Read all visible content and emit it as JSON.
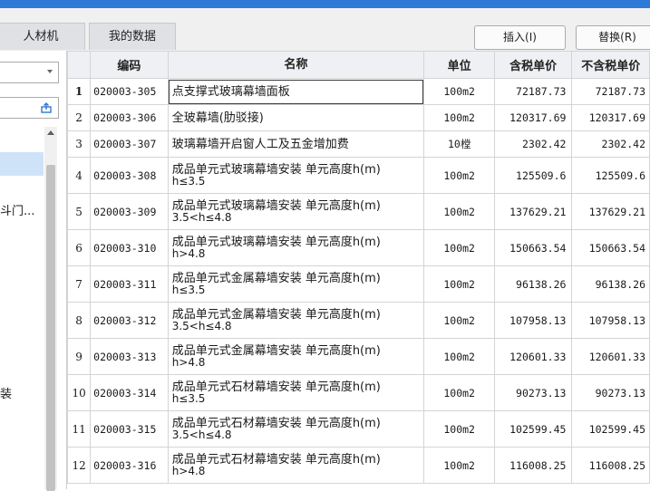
{
  "tabs": [
    {
      "label": "人材机"
    },
    {
      "label": "我的数据"
    }
  ],
  "toolbar": {
    "insert_label": "插入(I)",
    "replace_label": "替换(R)"
  },
  "left_panel": {
    "text1": "斗门...",
    "text2": "装"
  },
  "table": {
    "headers": [
      "",
      "编码",
      "名称",
      "单位",
      "含税单价",
      "不含税单价"
    ],
    "rows": [
      {
        "idx": "1",
        "code": "020003-305",
        "name": "点支撑式玻璃幕墙面板",
        "unit": "100m2",
        "price_tax": "72187.73",
        "price_notax": "72187.73"
      },
      {
        "idx": "2",
        "code": "020003-306",
        "name": "全玻幕墙(肋驳接)",
        "unit": "100m2",
        "price_tax": "120317.69",
        "price_notax": "120317.69"
      },
      {
        "idx": "3",
        "code": "020003-307",
        "name": "玻璃幕墙开启窗人工及五金增加费",
        "unit": "10樘",
        "price_tax": "2302.42",
        "price_notax": "2302.42"
      },
      {
        "idx": "4",
        "code": "020003-308",
        "name": "成品单元式玻璃幕墙安装 单元高度h(m)",
        "name2": "h≤3.5",
        "unit": "100m2",
        "price_tax": "125509.6",
        "price_notax": "125509.6"
      },
      {
        "idx": "5",
        "code": "020003-309",
        "name": "成品单元式玻璃幕墙安装 单元高度h(m)",
        "name2": "3.5<h≤4.8",
        "unit": "100m2",
        "price_tax": "137629.21",
        "price_notax": "137629.21"
      },
      {
        "idx": "6",
        "code": "020003-310",
        "name": "成品单元式玻璃幕墙安装 单元高度h(m)",
        "name2": "h>4.8",
        "unit": "100m2",
        "price_tax": "150663.54",
        "price_notax": "150663.54"
      },
      {
        "idx": "7",
        "code": "020003-311",
        "name": "成品单元式金属幕墙安装 单元高度h(m)",
        "name2": "h≤3.5",
        "unit": "100m2",
        "price_tax": "96138.26",
        "price_notax": "96138.26"
      },
      {
        "idx": "8",
        "code": "020003-312",
        "name": "成品单元式金属幕墙安装 单元高度h(m)",
        "name2": "3.5<h≤4.8",
        "unit": "100m2",
        "price_tax": "107958.13",
        "price_notax": "107958.13"
      },
      {
        "idx": "9",
        "code": "020003-313",
        "name": "成品单元式金属幕墙安装 单元高度h(m)",
        "name2": "h>4.8",
        "unit": "100m2",
        "price_tax": "120601.33",
        "price_notax": "120601.33"
      },
      {
        "idx": "10",
        "code": "020003-314",
        "name": "成品单元式石材幕墙安装 单元高度h(m)",
        "name2": "h≤3.5",
        "unit": "100m2",
        "price_tax": "90273.13",
        "price_notax": "90273.13"
      },
      {
        "idx": "11",
        "code": "020003-315",
        "name": "成品单元式石材幕墙安装 单元高度h(m)",
        "name2": "3.5<h≤4.8",
        "unit": "100m2",
        "price_tax": "102599.45",
        "price_notax": "102599.45"
      },
      {
        "idx": "12",
        "code": "020003-316",
        "name": "成品单元式石材幕墙安装 单元高度h(m)",
        "name2": "h>4.8",
        "unit": "100m2",
        "price_tax": "116008.25",
        "price_notax": "116008.25"
      }
    ]
  },
  "colors": {
    "title_bar": "#2e7ad6",
    "selection": "#cfe3f8",
    "header_bg": "#eef0f3"
  }
}
